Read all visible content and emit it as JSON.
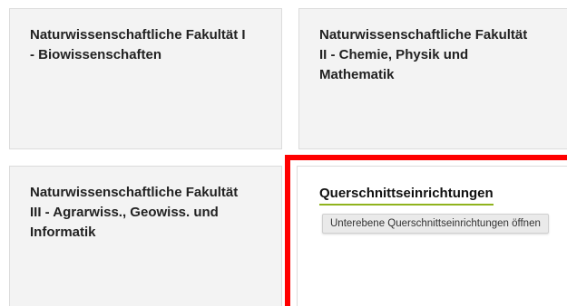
{
  "tiles": [
    {
      "label": "Naturwissenschaftliche Fakultät I\n- Biowissenschaften"
    },
    {
      "label": "Naturwissenschaftliche Fakultät\nII - Chemie, Physik und\nMathematik"
    },
    {
      "label": "Naturwissenschaftliche Fakultät\nIII - Agrarwiss., Geowiss. und\nInformatik"
    },
    {
      "label": "Querschnittseinrichtungen",
      "tooltip": "Unterebene Querschnittseinrichtungen öffnen"
    }
  ],
  "colors": {
    "highlight_border": "#ff0000",
    "link_underline": "#8fb31d",
    "tile_background": "#f3f3f3"
  }
}
